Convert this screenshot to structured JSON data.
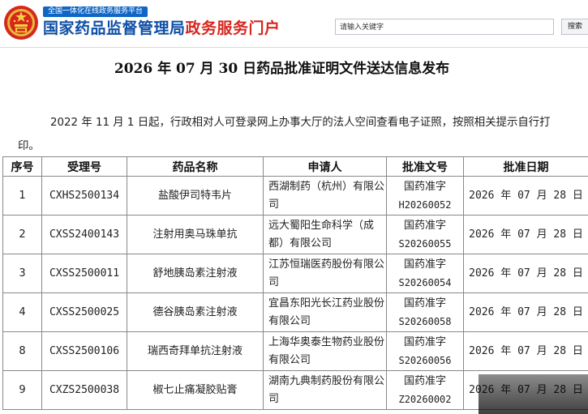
{
  "header": {
    "sub_title": "全国一体化在线政务服务平台",
    "title_main": "国家药品监督管理局",
    "title_red": "政务服务门户",
    "search_placeholder": "请输入关键字",
    "search_button": "搜索"
  },
  "article": {
    "title": "2026 年 07 月 30 日药品批准证明文件送达信息发布",
    "notice": "2022 年 11 月 1 日起，行政相对人可登录网上办事大厅的法人空间查看电子证照，按照相关提示自行打印。"
  },
  "table": {
    "columns": [
      "序号",
      "受理号",
      "药品名称",
      "申请人",
      "批准文号",
      "批准日期"
    ],
    "rows": [
      {
        "seq": "1",
        "accept_no": "CXHS2500134",
        "drug": "盐酸伊司特韦片",
        "applicant": "西湖制药（杭州）有限公司",
        "approval_prefix": "国药准字",
        "approval_no": "H20260052",
        "date": "2026 年 07 月 28 日"
      },
      {
        "seq": "2",
        "accept_no": "CXSS2400143",
        "drug": "注射用奥马珠单抗",
        "applicant": "远大蜀阳生命科学（成都）有限公司",
        "approval_prefix": "国药准字",
        "approval_no": "S20260055",
        "date": "2026 年 07 月 28 日"
      },
      {
        "seq": "3",
        "accept_no": "CXSS2500011",
        "drug": "舒地胰岛素注射液",
        "applicant": "江苏恒瑞医药股份有限公司",
        "approval_prefix": "国药准字",
        "approval_no": "S20260054",
        "date": "2026 年 07 月 28 日"
      },
      {
        "seq": "4",
        "accept_no": "CXSS2500025",
        "drug": "德谷胰岛素注射液",
        "applicant": "宜昌东阳光长江药业股份有限公司",
        "approval_prefix": "国药准字",
        "approval_no": "S20260058",
        "date": "2026 年 07 月 28 日"
      },
      {
        "seq": "8",
        "accept_no": "CXSS2500106",
        "drug": "瑞西奇拜单抗注射液",
        "applicant": "上海华奥泰生物药业股份有限公司",
        "approval_prefix": "国药准字",
        "approval_no": "S20260056",
        "date": "2026 年 07 月 28 日"
      },
      {
        "seq": "9",
        "accept_no": "CXZS2500038",
        "drug": "椒七止痛凝胶贴膏",
        "applicant": "湖南九典制药股份有限公司",
        "approval_prefix": "国药准字",
        "approval_no": "Z20260002",
        "date": "2026 年 07 月 28 日"
      }
    ]
  },
  "colors": {
    "brand_blue": "#0d4ea6",
    "brand_red": "#d7261e",
    "sub_bg": "#0f66c5"
  },
  "icons": {
    "emblem": "national-emblem-icon"
  }
}
